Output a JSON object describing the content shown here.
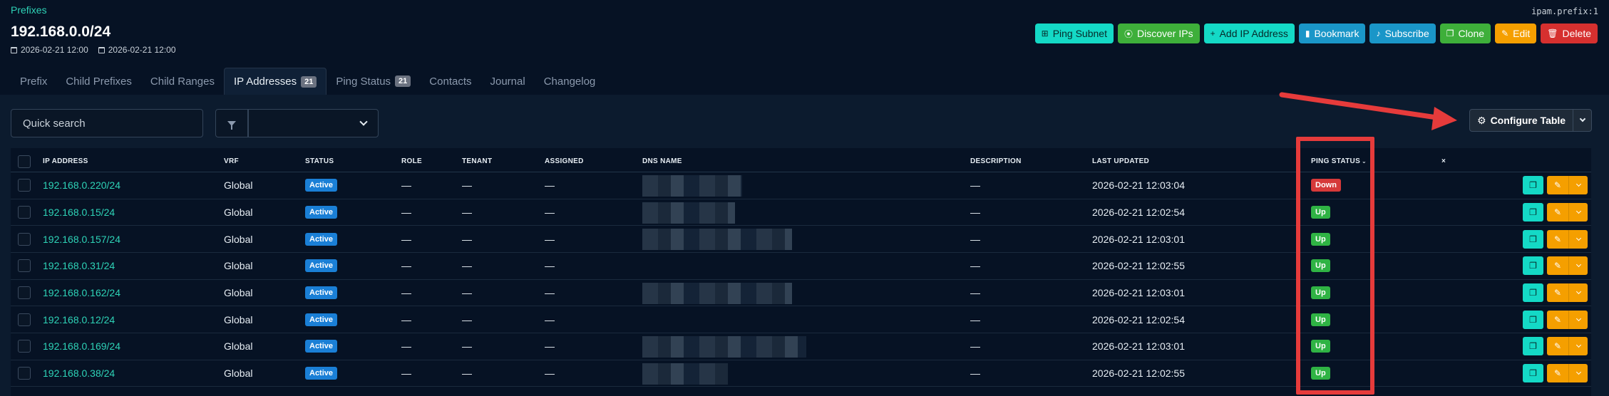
{
  "breadcrumb": "Prefixes",
  "object_id": "ipam.prefix:1",
  "title": "192.168.0.0/24",
  "timestamps": {
    "created": "2026-02-21 12:00",
    "updated": "2026-02-21 12:00"
  },
  "actions": {
    "ping_subnet": "Ping Subnet",
    "discover_ips": "Discover IPs",
    "add_ip": "Add IP Address",
    "bookmark": "Bookmark",
    "subscribe": "Subscribe",
    "clone": "Clone",
    "edit": "Edit",
    "delete": "Delete"
  },
  "tabs": [
    {
      "label": "Prefix"
    },
    {
      "label": "Child Prefixes"
    },
    {
      "label": "Child Ranges"
    },
    {
      "label": "IP Addresses",
      "count": "21"
    },
    {
      "label": "Ping Status",
      "count": "21"
    },
    {
      "label": "Contacts"
    },
    {
      "label": "Journal"
    },
    {
      "label": "Changelog"
    }
  ],
  "search": {
    "placeholder": "Quick search"
  },
  "configure_table": "Configure Table",
  "columns": {
    "ip": "IP ADDRESS",
    "vrf": "VRF",
    "status": "STATUS",
    "role": "ROLE",
    "tenant": "TENANT",
    "assigned": "ASSIGNED",
    "dns": "DNS NAME",
    "description": "DESCRIPTION",
    "last_updated": "LAST UPDATED",
    "ping_status": "PING STATUS",
    "clear": "×"
  },
  "rows": [
    {
      "ip": "192.168.0.220/24",
      "vrf": "Global",
      "status": "Active",
      "role": "—",
      "tenant": "—",
      "assigned": "—",
      "description": "—",
      "last_updated": "2026-02-21 12:03:04",
      "ping": "Down"
    },
    {
      "ip": "192.168.0.15/24",
      "vrf": "Global",
      "status": "Active",
      "role": "—",
      "tenant": "—",
      "assigned": "—",
      "description": "—",
      "last_updated": "2026-02-21 12:02:54",
      "ping": "Up"
    },
    {
      "ip": "192.168.0.157/24",
      "vrf": "Global",
      "status": "Active",
      "role": "—",
      "tenant": "—",
      "assigned": "—",
      "description": "—",
      "last_updated": "2026-02-21 12:03:01",
      "ping": "Up"
    },
    {
      "ip": "192.168.0.31/24",
      "vrf": "Global",
      "status": "Active",
      "role": "—",
      "tenant": "—",
      "assigned": "—",
      "description": "—",
      "last_updated": "2026-02-21 12:02:55",
      "ping": "Up"
    },
    {
      "ip": "192.168.0.162/24",
      "vrf": "Global",
      "status": "Active",
      "role": "—",
      "tenant": "—",
      "assigned": "—",
      "description": "—",
      "last_updated": "2026-02-21 12:03:01",
      "ping": "Up"
    },
    {
      "ip": "192.168.0.12/24",
      "vrf": "Global",
      "status": "Active",
      "role": "—",
      "tenant": "—",
      "assigned": "—",
      "description": "—",
      "last_updated": "2026-02-21 12:02:54",
      "ping": "Up"
    },
    {
      "ip": "192.168.0.169/24",
      "vrf": "Global",
      "status": "Active",
      "role": "—",
      "tenant": "—",
      "assigned": "—",
      "description": "—",
      "last_updated": "2026-02-21 12:03:01",
      "ping": "Up"
    },
    {
      "ip": "192.168.0.38/24",
      "vrf": "Global",
      "status": "Active",
      "role": "—",
      "tenant": "—",
      "assigned": "—",
      "description": "—",
      "last_updated": "2026-02-21 12:02:55",
      "ping": "Up"
    }
  ],
  "colors": {
    "accent": "#2ed3b7",
    "ping_up": "#2fb344",
    "ping_down": "#d63939",
    "annotation": "#e63b3b"
  }
}
